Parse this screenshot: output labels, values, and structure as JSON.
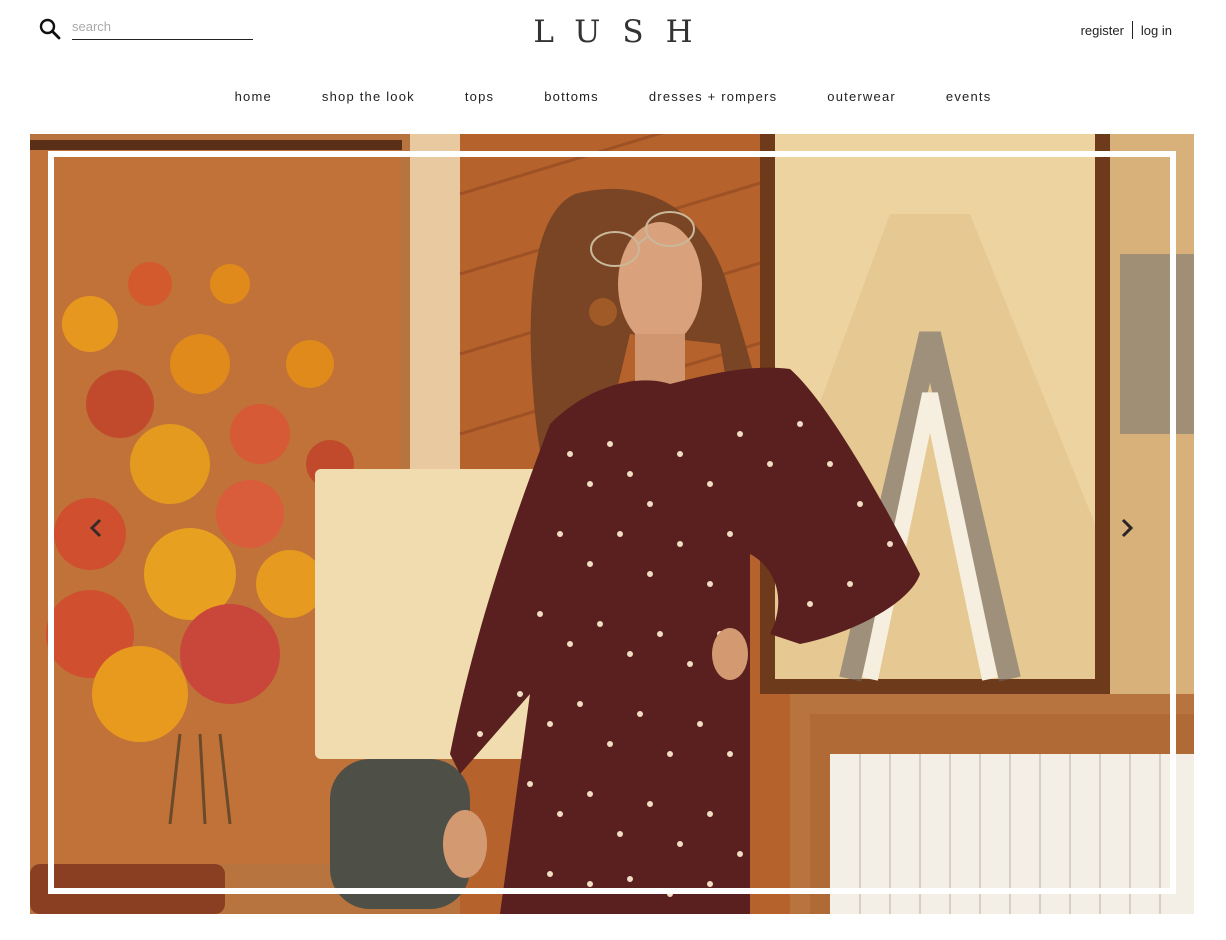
{
  "header": {
    "search": {
      "placeholder": "search",
      "value": "",
      "icon": "search-icon"
    },
    "logo": "LUSH",
    "account": {
      "register": "register",
      "login": "log in"
    }
  },
  "nav": {
    "items": [
      {
        "label": "home"
      },
      {
        "label": "shop the look"
      },
      {
        "label": "tops"
      },
      {
        "label": "bottoms"
      },
      {
        "label": "dresses + rompers"
      },
      {
        "label": "outerwear"
      },
      {
        "label": "events"
      }
    ]
  },
  "hero": {
    "prev_icon": "chevron-left-icon",
    "next_icon": "chevron-right-icon",
    "frame_color": "#ffffff",
    "dress_color": "#5a1f1f"
  },
  "colors": {
    "text": "#222222",
    "background": "#ffffff"
  }
}
